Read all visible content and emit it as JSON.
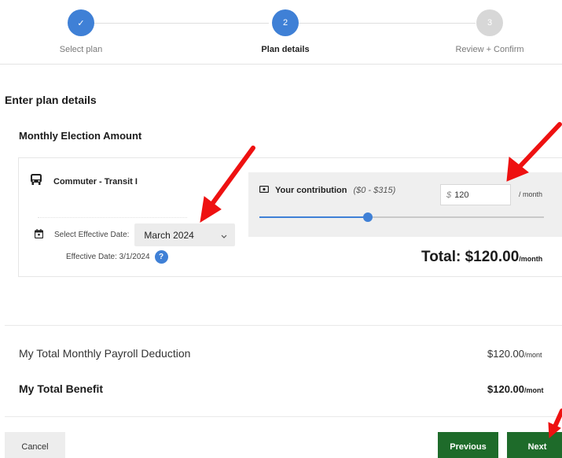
{
  "stepper": {
    "steps": [
      {
        "number": "✓",
        "label": "Select plan",
        "state": "done"
      },
      {
        "number": "2",
        "label": "Plan details",
        "state": "current"
      },
      {
        "number": "3",
        "label": "Review + Confirm",
        "state": "todo"
      }
    ]
  },
  "page": {
    "section_title": "Enter plan details",
    "sub_title": "Monthly Election Amount"
  },
  "plan": {
    "name": "Commuter - Transit I",
    "icon": "bus-icon",
    "date_label": "Select Effective Date:",
    "date_value": "March 2024",
    "effective_text": "Effective Date: 3/1/2024",
    "help_glyph": "?"
  },
  "contribution": {
    "title": "Your contribution",
    "range": "($0 - $315)",
    "currency": "$",
    "amount": "120",
    "per": "/ month",
    "slider_fraction": 0.381
  },
  "total": {
    "label": "Total: $120.00",
    "unit": "/month"
  },
  "summary": {
    "payroll_label": "My Total Monthly Payroll Deduction",
    "payroll_value": "$120.00",
    "payroll_unit": "/mont",
    "benefit_label": "My Total Benefit",
    "benefit_value": "$120.00",
    "benefit_unit": "/mont"
  },
  "buttons": {
    "cancel": "Cancel",
    "previous": "Previous",
    "next": "Next"
  },
  "colors": {
    "accent_blue": "#3f80d6",
    "button_green": "#1e6b2a",
    "annotation_red": "#ee1111"
  }
}
